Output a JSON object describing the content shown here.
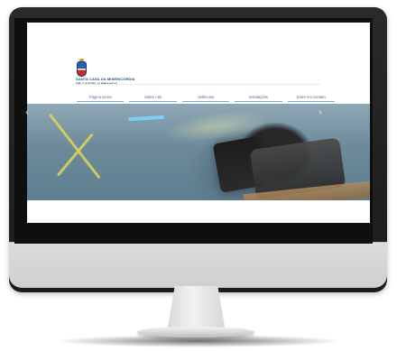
{
  "site": {
    "brand_line1": "SANTA CASA DA MISERICÓRDIA",
    "brand_line2": "DE CASTELO BRANCO",
    "nav": [
      {
        "label": "Página inicial"
      },
      {
        "label": "Sobre nós"
      },
      {
        "label": "Valências"
      },
      {
        "label": "Instalações"
      },
      {
        "label": "Entre em contato"
      }
    ],
    "slider": {
      "prev": "‹",
      "next": "›"
    }
  },
  "colors": {
    "nav_text": "#4b6e95",
    "nav_underline": "#6fb0dd",
    "brand": "#2c4c7a"
  }
}
